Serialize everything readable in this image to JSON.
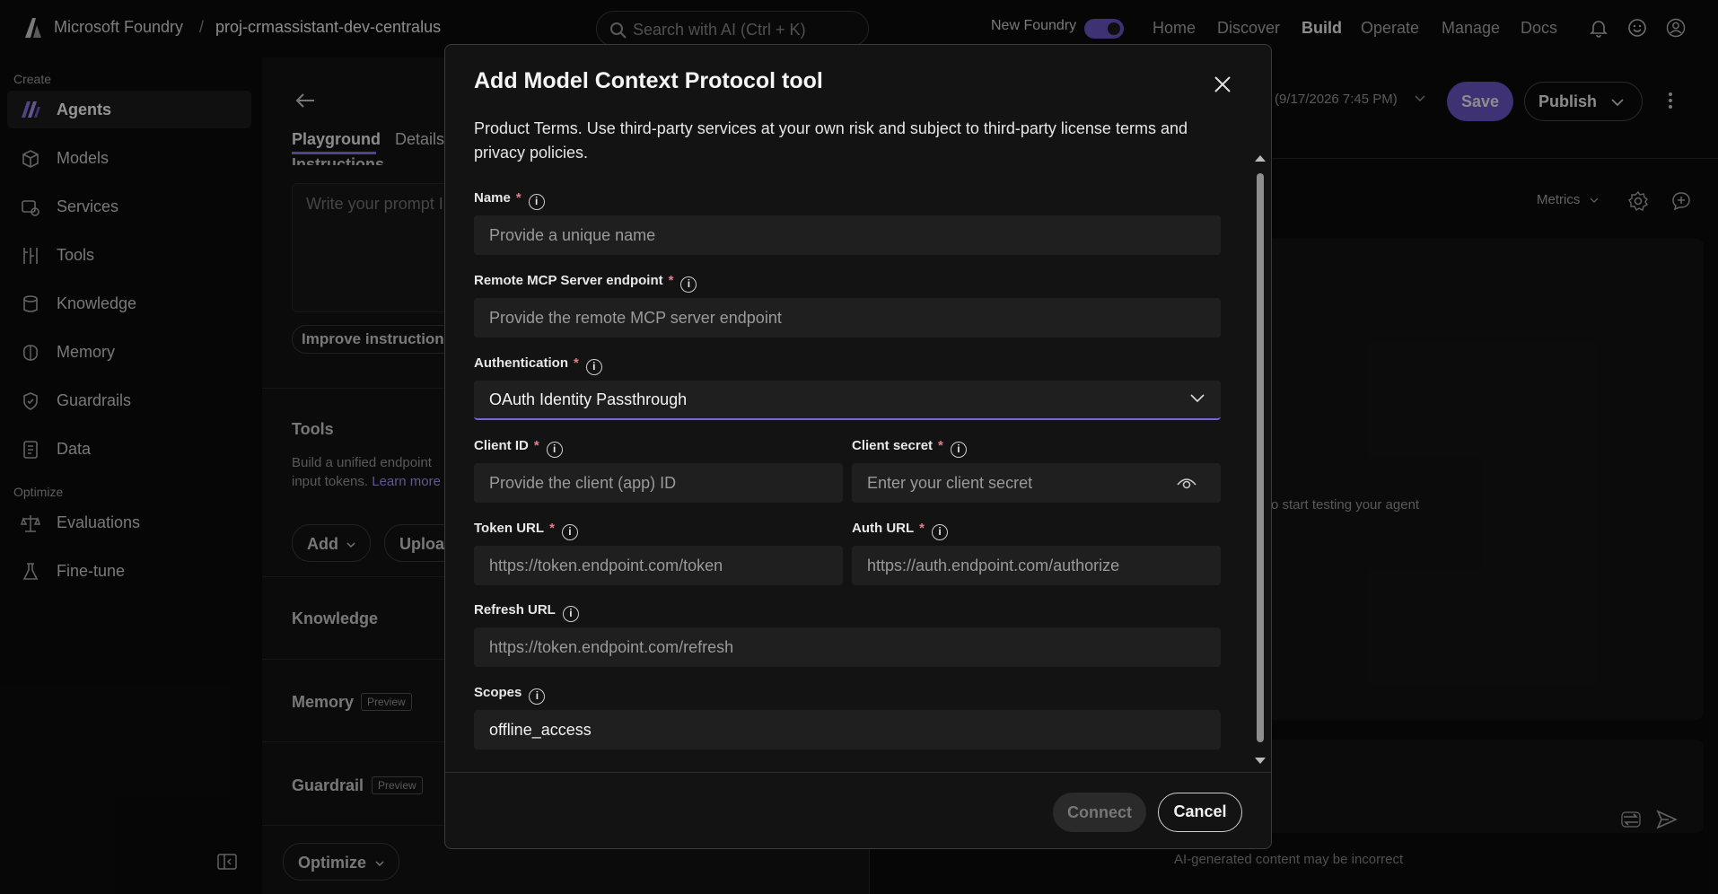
{
  "topbar": {
    "brand": "Microsoft Foundry",
    "separator": "/",
    "project": "proj-crmassistant-dev-centralus",
    "search_placeholder": "Search with AI (Ctrl + K)",
    "new_foundry_label": "New Foundry",
    "nav": [
      "Home",
      "Discover",
      "Build",
      "Operate",
      "Manage",
      "Docs"
    ],
    "active_nav": "Build",
    "icons": [
      "bell-icon",
      "smiley-icon",
      "person-icon"
    ]
  },
  "sidebar": {
    "create_label": "Create",
    "create_items": [
      {
        "label": "Agents",
        "icon": "agents-icon"
      },
      {
        "label": "Models",
        "icon": "models-icon"
      },
      {
        "label": "Services",
        "icon": "services-icon"
      },
      {
        "label": "Tools",
        "icon": "tools-icon"
      },
      {
        "label": "Knowledge",
        "icon": "knowledge-icon"
      },
      {
        "label": "Memory",
        "icon": "memory-icon"
      },
      {
        "label": "Guardrails",
        "icon": "guardrails-icon"
      },
      {
        "label": "Data",
        "icon": "data-icon"
      }
    ],
    "optimize_label": "Optimize",
    "optimize_items": [
      {
        "label": "Evaluations",
        "icon": "evaluations-icon"
      },
      {
        "label": "Fine-tune",
        "icon": "finetune-icon"
      }
    ],
    "active": "Agents"
  },
  "middle": {
    "tab_playground": "Playground",
    "tab_details": "Details",
    "instructions_heading": "Instructions",
    "prompt_placeholder": "Write your prompt I",
    "improve_button": "Improve instruction",
    "tools_heading": "Tools",
    "tools_desc_line1": "Build a unified endpoint",
    "tools_desc_line2": "input tokens.",
    "learn_more": "Learn more",
    "add_button": "Add",
    "upload_button": "Uploa",
    "knowledge_heading": "Knowledge",
    "memory_heading": "Memory",
    "guardrail_heading": "Guardrail",
    "preview_badge": "Preview",
    "optimize_button": "Optimize"
  },
  "right": {
    "version_text": "(9/17/2026 7:45 PM)",
    "save_button": "Save",
    "publish_button": "Publish",
    "metrics_label": "Metrics",
    "empty_hint": "o start testing your agent",
    "footer_note": "AI-generated content may be incorrect"
  },
  "modal": {
    "title": "Add Model Context Protocol tool",
    "intro_line1": "Product Terms. Use third-party services at your own risk and subject to third-party license terms and",
    "intro_line2": "privacy policies.",
    "fields": {
      "name": {
        "label": "Name",
        "placeholder": "Provide a unique name"
      },
      "endpoint": {
        "label": "Remote MCP Server endpoint",
        "placeholder": "Provide the remote MCP server endpoint"
      },
      "auth": {
        "label": "Authentication",
        "value": "OAuth Identity Passthrough"
      },
      "client_id": {
        "label": "Client ID",
        "placeholder": "Provide the client (app) ID"
      },
      "client_secret": {
        "label": "Client secret",
        "placeholder": "Enter your client secret"
      },
      "token_url": {
        "label": "Token URL",
        "placeholder": "https://token.endpoint.com/token"
      },
      "auth_url": {
        "label": "Auth URL",
        "placeholder": "https://auth.endpoint.com/authorize"
      },
      "refresh_url": {
        "label": "Refresh URL",
        "placeholder": "https://token.endpoint.com/refresh"
      },
      "scopes": {
        "label": "Scopes",
        "value": "offline_access"
      }
    },
    "required_mark": "*",
    "connect_button": "Connect",
    "cancel_button": "Cancel"
  },
  "colors": {
    "accent": "#6b55c9",
    "required": "#e37d8a"
  }
}
